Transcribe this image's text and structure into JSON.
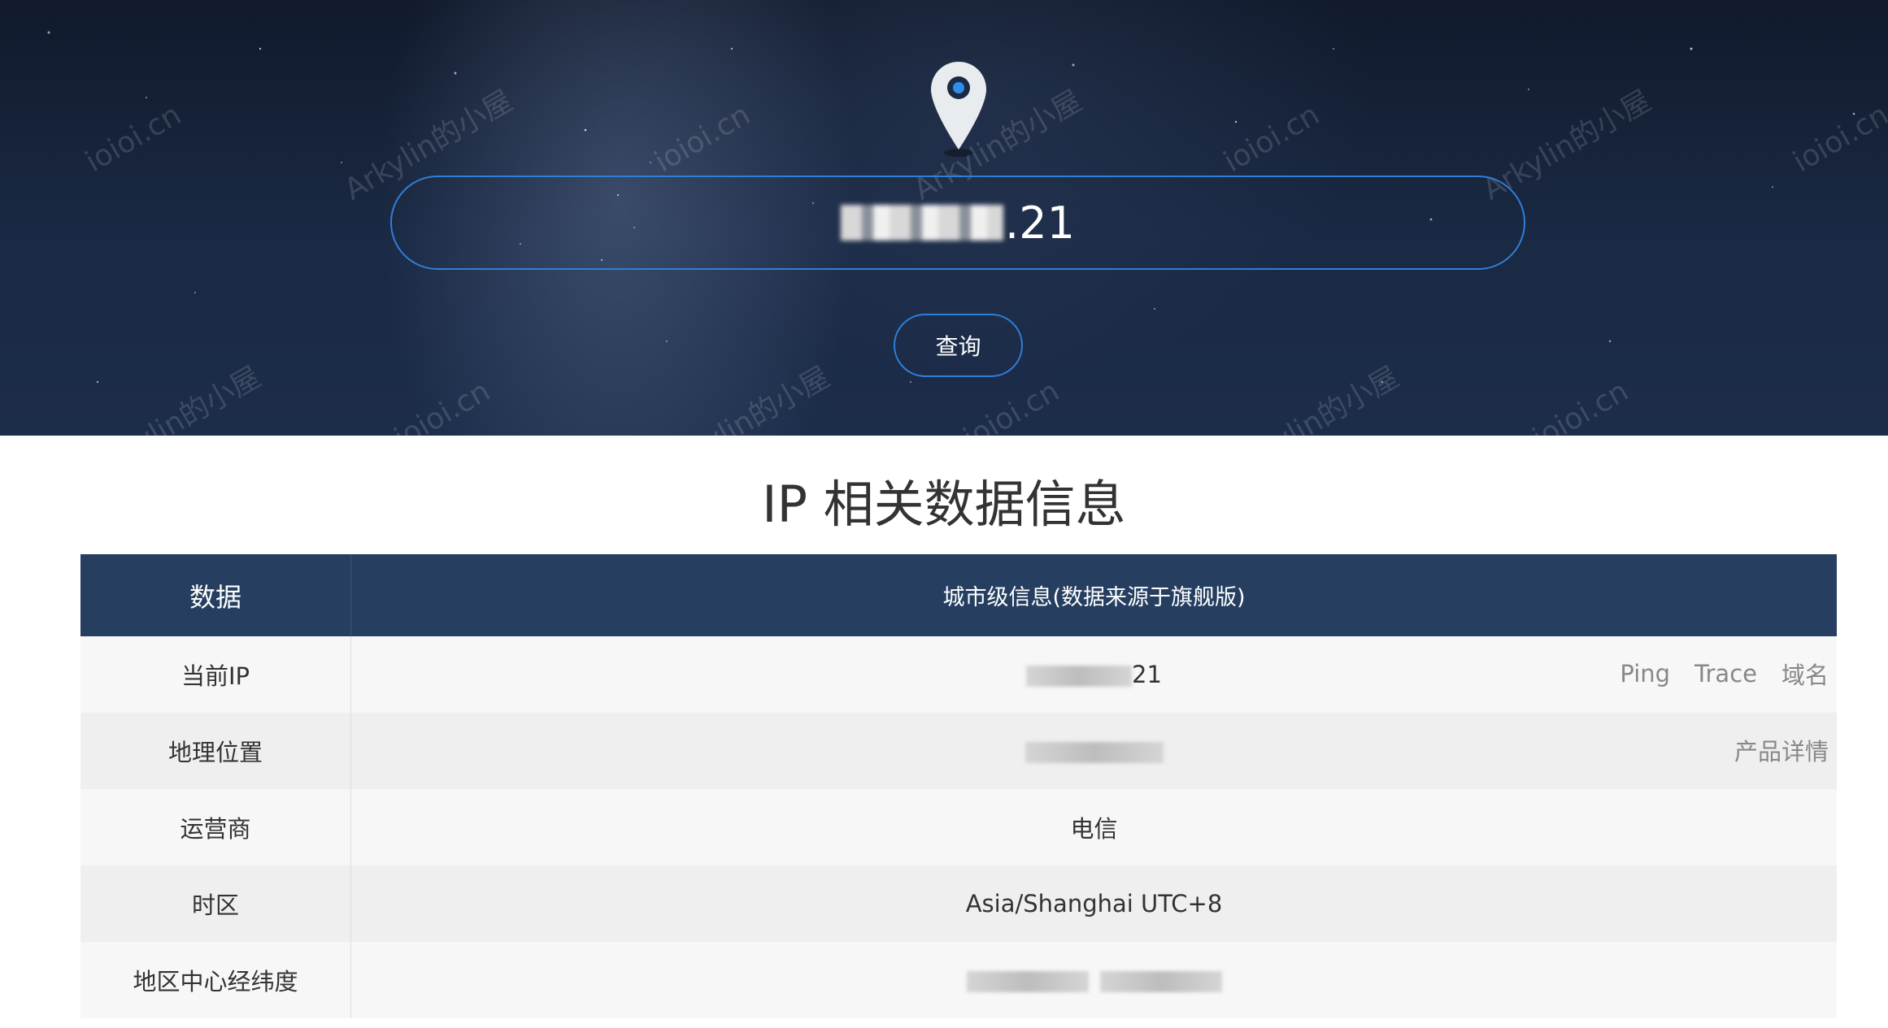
{
  "hero": {
    "watermarks": [
      "ioioi.cn",
      "Arkylin的小屋"
    ],
    "ip_value_visible": ".21",
    "query_label": "查询"
  },
  "section": {
    "title": "IP 相关数据信息"
  },
  "table": {
    "headers": [
      "数据",
      "城市级信息(数据来源于旗舰版)"
    ],
    "rows": [
      {
        "label": "当前IP",
        "value_visible": "21",
        "actions": [
          "Ping",
          "Trace",
          "域名"
        ]
      },
      {
        "label": "地理位置",
        "value_visible": "",
        "actions": [
          "产品详情"
        ]
      },
      {
        "label": "运营商",
        "value_visible": "电信",
        "actions": []
      },
      {
        "label": "时区",
        "value_visible": "Asia/Shanghai UTC+8",
        "actions": []
      },
      {
        "label": "地区中心经纬度",
        "value_visible": "",
        "actions": []
      }
    ]
  },
  "colors": {
    "accent": "#2f7fd6",
    "header_bg": "#263f61",
    "hero_bg": "#1a2944"
  },
  "icons": {
    "pin": "location-pin-icon"
  }
}
